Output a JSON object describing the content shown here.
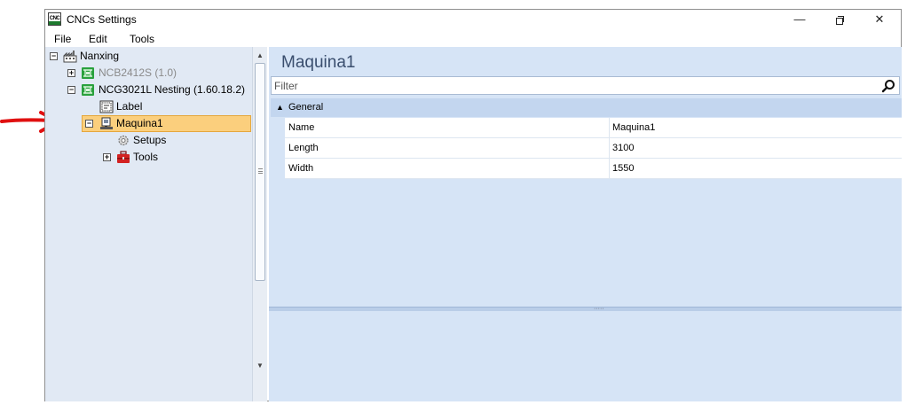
{
  "window": {
    "title": "CNCs Settings",
    "app_icon_text": "CNC",
    "controls": {
      "minimize": "—",
      "maximize": "",
      "close": "✕"
    }
  },
  "menu": [
    "File",
    "Edit",
    "Tools"
  ],
  "tree": {
    "root": {
      "label": "Nanxing",
      "expander": "⊟",
      "icon": "factory-icon"
    },
    "items": [
      {
        "label": "NCB2412S (1.0)",
        "expander": "+",
        "icon": "cnc-machine-icon",
        "state": "inactive"
      },
      {
        "label": "NCG3021L Nesting (1.60.18.2)",
        "expander": "−",
        "icon": "cnc-machine-icon",
        "state": "active"
      },
      {
        "label": "Label",
        "icon": "label-icon"
      },
      {
        "label": "Maquina1",
        "expander": "−",
        "icon": "machine-icon",
        "selected": true
      },
      {
        "label": "Setups",
        "icon": "gear-icon"
      },
      {
        "label": "Tools",
        "expander": "+",
        "icon": "toolbox-icon"
      }
    ]
  },
  "details": {
    "title": "Maquina1",
    "filter_placeholder": "Filter",
    "group": {
      "label": "General",
      "caret": "▲"
    },
    "properties": [
      {
        "name": "Name",
        "value": "Maquina1"
      },
      {
        "name": "Length",
        "value": "3100"
      },
      {
        "name": "Width",
        "value": "1550"
      }
    ]
  },
  "colors": {
    "selection": "#fbcf7d",
    "tree_bg": "#e1e9f4",
    "details_bg": "#d6e4f6",
    "group_header": "#c3d6ef",
    "title_text": "#3a4e6e",
    "annotation_arrow": "#e01010"
  }
}
